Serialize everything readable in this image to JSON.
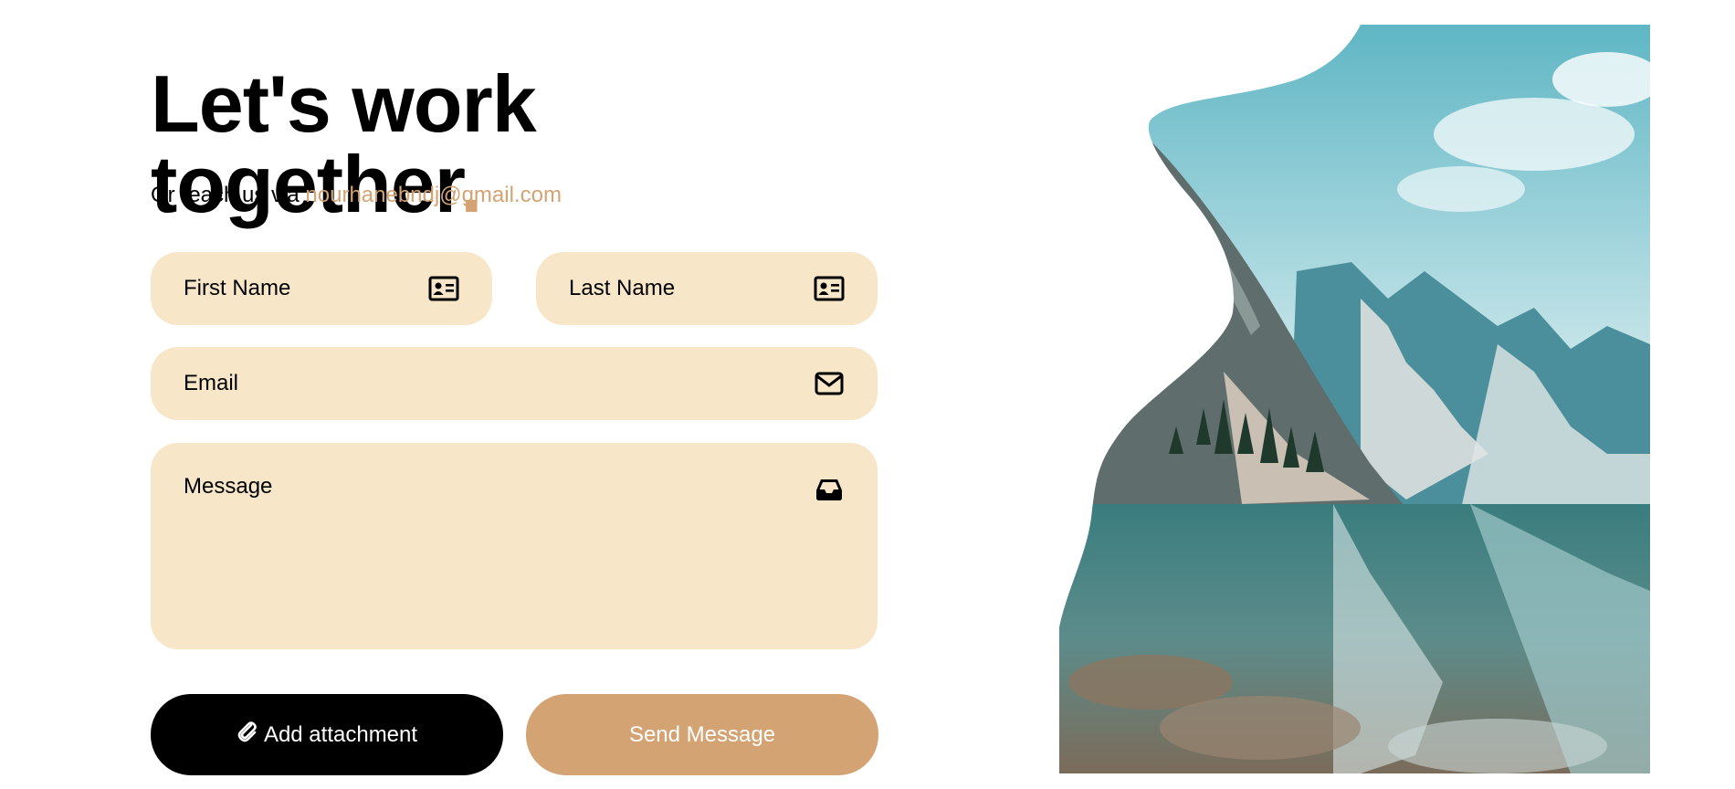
{
  "header": {
    "title": "Let's work together",
    "title_dot": ".",
    "subtitle_prefix": "Or reach us via",
    "email": "nourhanebndj@gmail.com"
  },
  "form": {
    "first_name_placeholder": "First Name",
    "last_name_placeholder": "Last Name",
    "email_placeholder": "Email",
    "message_placeholder": "Message"
  },
  "buttons": {
    "attach_label": "Add attachment",
    "send_label": "Send Message"
  },
  "icons": {
    "first_name": "id-card-icon",
    "last_name": "id-card-icon",
    "email": "envelope-icon",
    "message": "inbox-icon",
    "attach": "paperclip-icon"
  },
  "colors": {
    "accent": "#d4a373",
    "field_bg": "#f8e6c8",
    "text": "#000000",
    "button_dark": "#000000"
  }
}
